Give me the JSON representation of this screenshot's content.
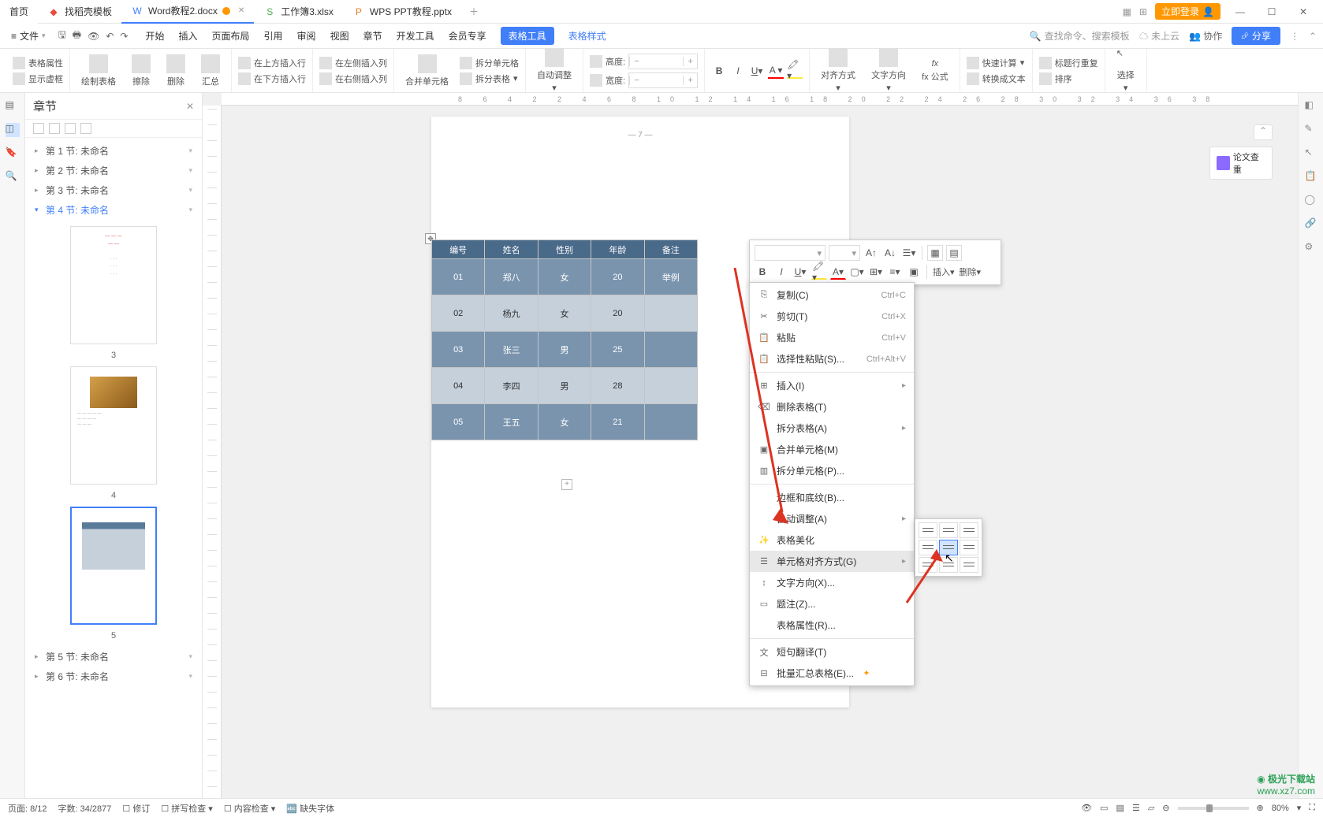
{
  "titlebar": {
    "home": "首页",
    "tabs": [
      {
        "icon": "pdf-icon",
        "label": "找稻壳模板",
        "color": "#e74c3c"
      },
      {
        "icon": "word-icon",
        "label": "Word教程2.docx",
        "color": "#417ff9",
        "active": true,
        "dot": true
      },
      {
        "icon": "excel-icon",
        "label": "工作簿3.xlsx",
        "color": "#4caf50"
      },
      {
        "icon": "ppt-icon",
        "label": "WPS PPT教程.pptx",
        "color": "#e67e22"
      }
    ],
    "login": "立即登录"
  },
  "menubar": {
    "file": "文件",
    "tabs": [
      "开始",
      "插入",
      "页面布局",
      "引用",
      "审阅",
      "视图",
      "章节",
      "开发工具",
      "会员专享"
    ],
    "highlight": "表格工具",
    "link": "表格样式",
    "search_placeholder": "查找命令、搜索模板",
    "cloud": "未上云",
    "collab": "协作",
    "share": "分享"
  },
  "ribbon": {
    "g1": {
      "a": "表格属性",
      "b": "显示虚框"
    },
    "g2": {
      "a": "绘制表格",
      "b": "擦除",
      "c": "删除",
      "d": "汇总"
    },
    "g3": {
      "a": "在上方插入行",
      "b": "在下方插入行",
      "c": "在左侧插入列",
      "d": "在右侧插入列"
    },
    "g4": {
      "a": "合并单元格",
      "b": "拆分单元格",
      "c": "拆分表格"
    },
    "g5": "自动调整",
    "g6": {
      "h": "高度:",
      "w": "宽度:"
    },
    "g7": {
      "align": "对齐方式",
      "dir": "文字方向",
      "fx": "fx 公式"
    },
    "g8": {
      "a": "快速计算",
      "b": "标题行重复",
      "c": "转换成文本",
      "d": "排序",
      "e": "选择"
    }
  },
  "nav": {
    "title": "章节",
    "sections": [
      {
        "label": "第 1 节: 未命名"
      },
      {
        "label": "第 2 节: 未命名"
      },
      {
        "label": "第 3 节: 未命名"
      },
      {
        "label": "第 4 节: 未命名",
        "expanded": true
      },
      {
        "label": "第 5 节: 未命名"
      },
      {
        "label": "第 6 节: 未命名"
      }
    ],
    "thumb_nums": [
      "3",
      "4",
      "5"
    ]
  },
  "ruler": "8 6 4 2 2 4 6 8 10 12 14 16 18 20 22 24 26 28 30 32 34 36 38",
  "page": {
    "num": "— 7 —"
  },
  "table": {
    "headers": [
      "编号",
      "姓名",
      "性别",
      "年龄",
      "备注"
    ],
    "rows": [
      [
        "01",
        "郑八",
        "女",
        "20",
        "举例"
      ],
      [
        "02",
        "杨九",
        "女",
        "20",
        ""
      ],
      [
        "03",
        "张三",
        "男",
        "25",
        ""
      ],
      [
        "04",
        "李四",
        "男",
        "28",
        ""
      ],
      [
        "05",
        "王五",
        "女",
        "21",
        ""
      ]
    ]
  },
  "side": {
    "check": "论文查重"
  },
  "mini": {
    "insert": "插入",
    "delete": "删除"
  },
  "ctx": {
    "copy": "复制(C)",
    "copy_sc": "Ctrl+C",
    "cut": "剪切(T)",
    "cut_sc": "Ctrl+X",
    "paste": "粘贴",
    "paste_sc": "Ctrl+V",
    "paste_special": "选择性粘贴(S)...",
    "paste_special_sc": "Ctrl+Alt+V",
    "insert": "插入(I)",
    "delete_table": "删除表格(T)",
    "split_table": "拆分表格(A)",
    "merge_cells": "合并单元格(M)",
    "split_cells": "拆分单元格(P)...",
    "border": "边框和底纹(B)...",
    "auto_fit": "自动调整(A)",
    "beautify": "表格美化",
    "cell_align": "单元格对齐方式(G)",
    "text_dir": "文字方向(X)...",
    "caption": "题注(Z)...",
    "table_props": "表格属性(R)...",
    "translate": "短句翻译(T)",
    "batch": "批量汇总表格(E)..."
  },
  "status": {
    "page": "页面: 8/12",
    "words": "字数: 34/2877",
    "revise": "修订",
    "spell": "拼写检查",
    "content": "内容检查",
    "font": "缺失字体",
    "zoom": "80%"
  },
  "watermark": {
    "brand": "极光下载站",
    "url": "www.xz7.com"
  }
}
